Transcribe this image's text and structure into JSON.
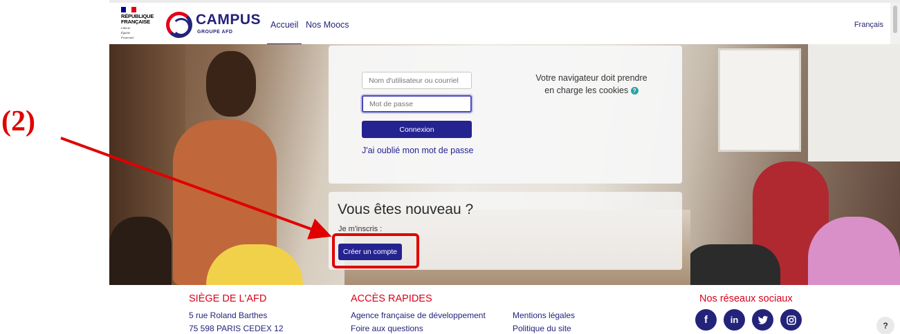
{
  "annotation": {
    "label": "(2)",
    "color": "#e00000"
  },
  "header": {
    "republic": {
      "line1": "RÉPUBLIQUE",
      "line2": "FRANÇAISE",
      "motto1": "Liberté",
      "motto2": "Égalité",
      "motto3": "Fraternité"
    },
    "brand": {
      "name": "CAMPUS",
      "sub": "GROUPE AFD",
      "color": "#24237a",
      "accent": "#e3001b"
    },
    "nav": [
      {
        "label": "Accueil",
        "active": true
      },
      {
        "label": "Nos Moocs",
        "active": false
      }
    ],
    "language": "Français"
  },
  "login": {
    "username_placeholder": "Nom d'utilisateur ou courriel",
    "password_placeholder": "Mot de passe",
    "submit_label": "Connexion",
    "forgot_label": "J'ai oublié mon mot de passe",
    "cookies_line1": "Votre navigateur doit prendre",
    "cookies_line2": "en charge les cookies",
    "help_icon": "?"
  },
  "signup": {
    "title": "Vous êtes nouveau ?",
    "subtitle": "Je m'inscris :",
    "button_label": "Créer un compte"
  },
  "footer": {
    "siege": {
      "title": "SIÈGE DE L'AFD",
      "lines": [
        "5 rue Roland Barthes",
        "75 598 PARIS CEDEX 12"
      ]
    },
    "acces": {
      "title": "ACCÈS RAPIDES",
      "col1": [
        "Agence française de développement",
        "Foire aux questions"
      ],
      "col2": [
        "Mentions légales",
        "Politique du site"
      ]
    },
    "social": {
      "title": "Nos réseaux sociaux",
      "icons": [
        "f",
        "in",
        "t",
        "ig"
      ]
    },
    "help": "?"
  },
  "colors": {
    "primary": "#25238f",
    "footer_heading": "#d8001a",
    "annotation": "#e00000"
  }
}
